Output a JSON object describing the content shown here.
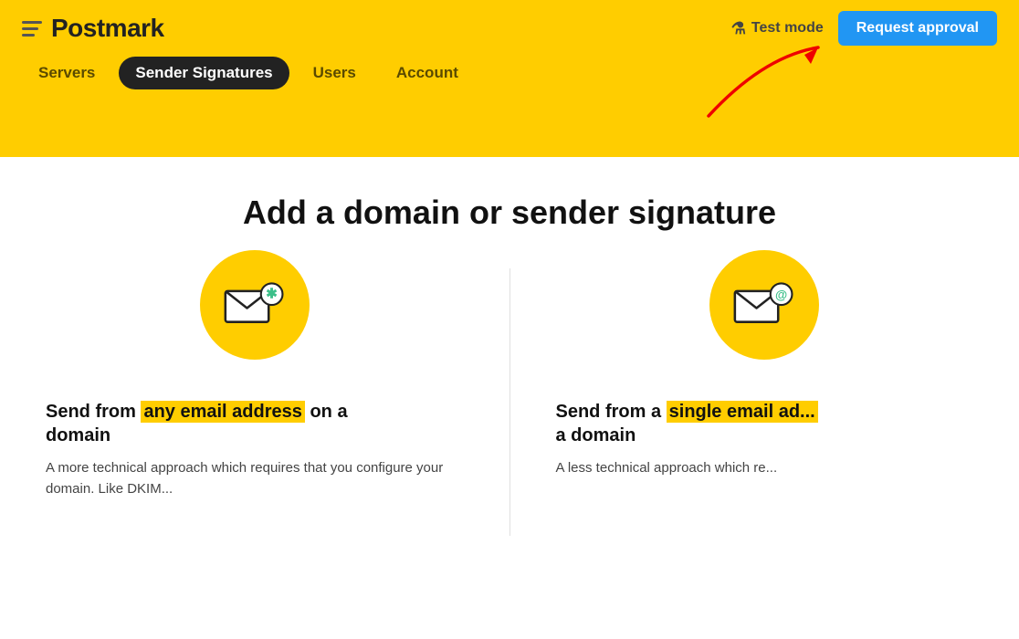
{
  "logo": {
    "text": "Postmark"
  },
  "header": {
    "test_mode_label": "Test mode",
    "request_approval_label": "Request approval"
  },
  "nav": {
    "items": [
      {
        "label": "Servers",
        "active": false
      },
      {
        "label": "Sender Signatures",
        "active": true
      },
      {
        "label": "Users",
        "active": false
      },
      {
        "label": "Account",
        "active": false
      }
    ]
  },
  "page": {
    "title": "Add a domain or sender signature"
  },
  "cards": [
    {
      "title_before": "Send from ",
      "title_highlight": "any email address",
      "title_after": " on a domain",
      "description": "A more technical approach which requires that you configure your domain. Like DKIM..."
    },
    {
      "title_before": "Send from a ",
      "title_highlight": "single email ad...",
      "title_after": " a domain",
      "description": "A less technical approach which re..."
    }
  ]
}
